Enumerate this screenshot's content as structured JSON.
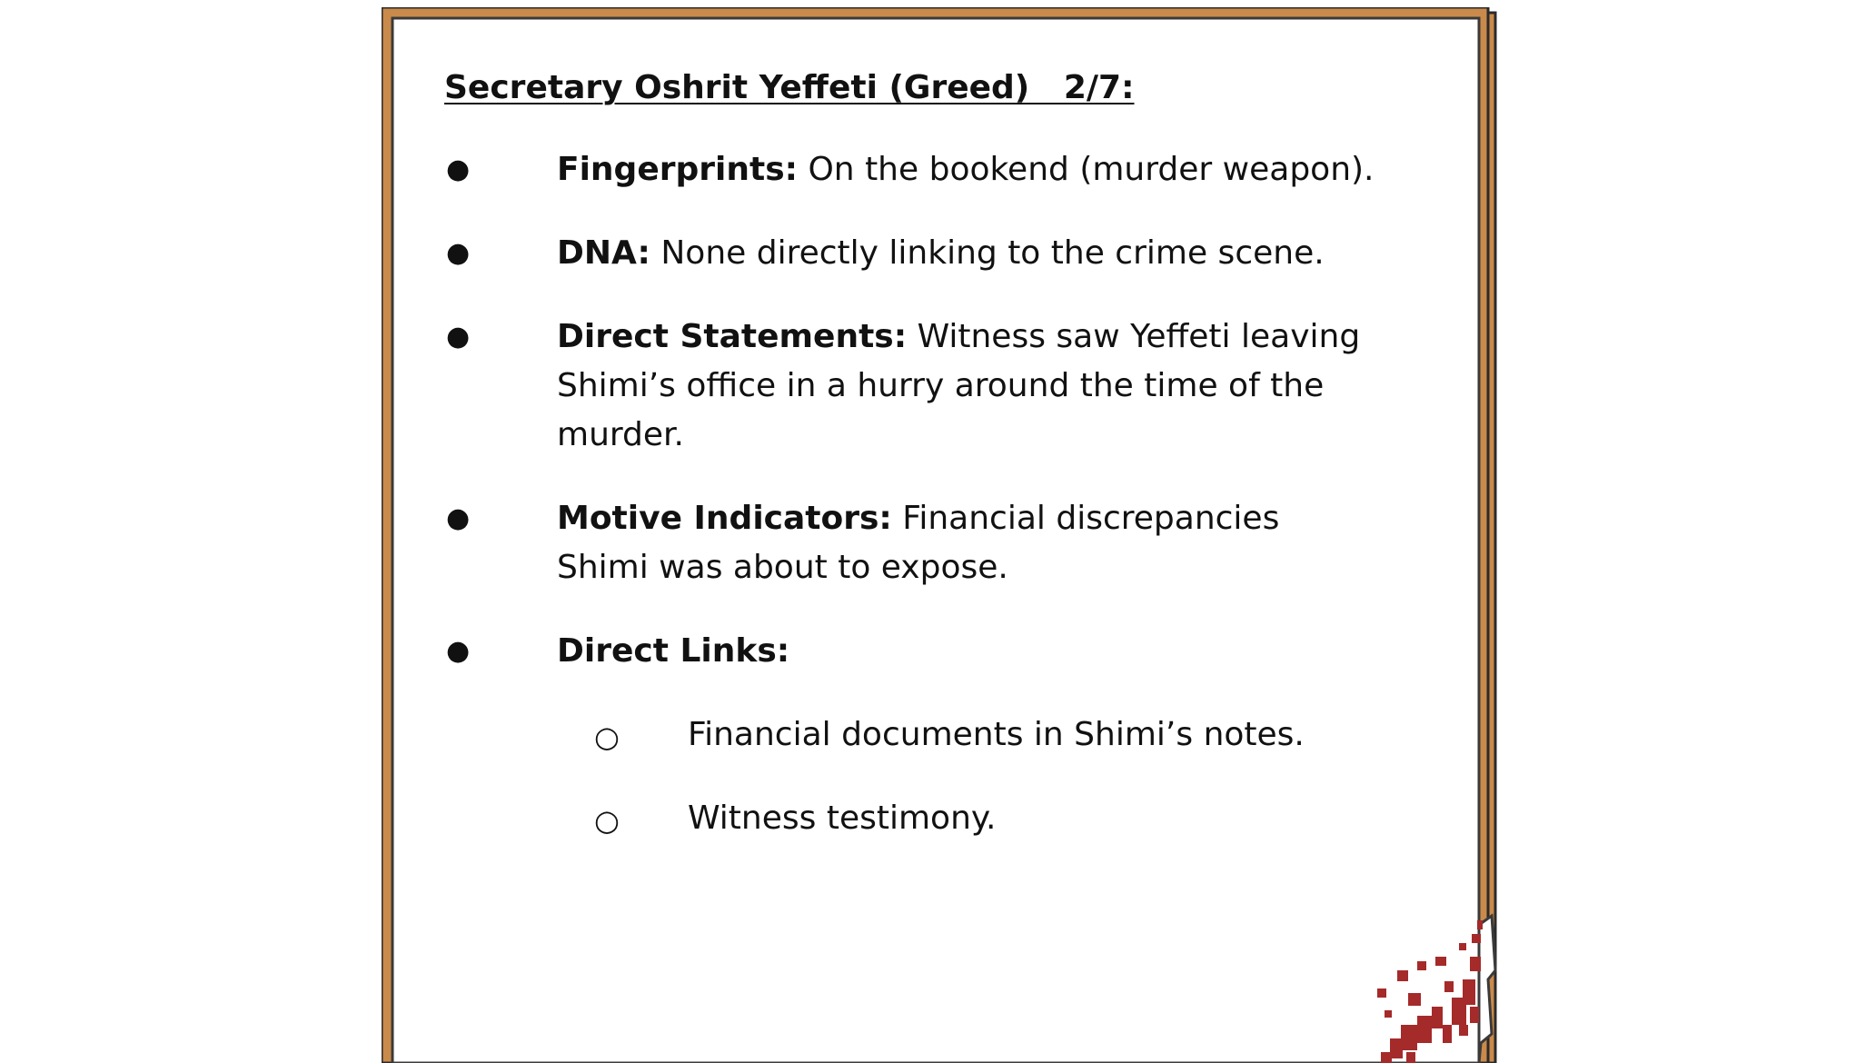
{
  "title": "Secretary Oshrit Yeffeti (Greed)   2/7:",
  "items": [
    {
      "label": "Fingerprints:",
      "text": " On the bookend (murder weapon)."
    },
    {
      "label": "DNA:",
      "text": " None directly linking to the crime scene."
    },
    {
      "label": "Direct Statements:",
      "text": " Witness saw Yeffeti leaving Shimi’s office in a hurry around the time of the murder."
    },
    {
      "label": "Motive Indicators:",
      "text": " Financial discrepancies Shimi was about to expose."
    },
    {
      "label": "Direct Links:",
      "text": ""
    }
  ],
  "subitems": [
    "Financial documents in Shimi’s notes.",
    "Witness testimony."
  ],
  "colors": {
    "frame": "#c98a4b",
    "frame_dark": "#2a2a2a",
    "blood": "#a52a2a"
  },
  "icons": {
    "bullet": "filled-circle",
    "subbullet": "hollow-circle",
    "decoration": "blood-splatter"
  }
}
